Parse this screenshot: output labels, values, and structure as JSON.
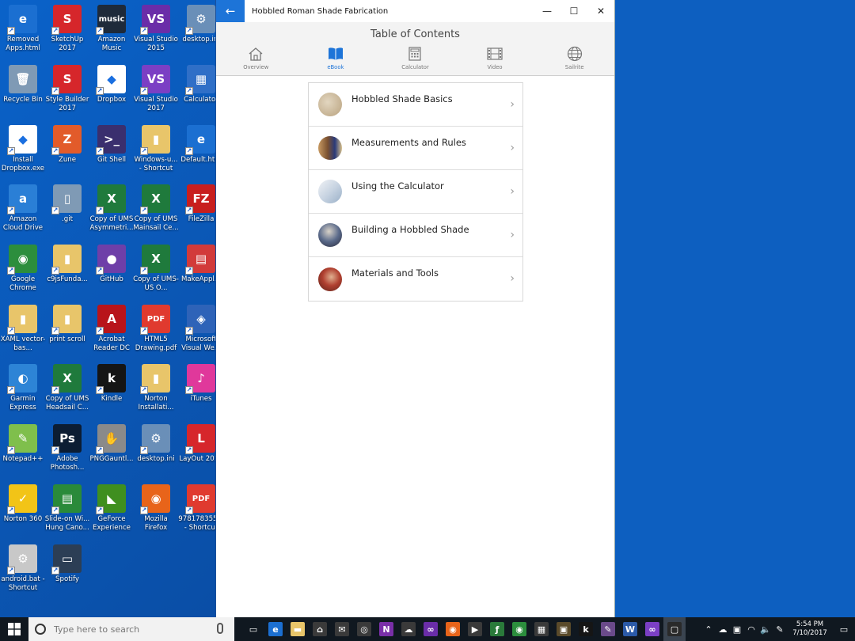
{
  "desktop": {
    "icons": [
      {
        "label": "Removed Apps.html",
        "color": "#1b6fd1",
        "glyph": "e"
      },
      {
        "label": "SketchUp 2017",
        "color": "#d6262b",
        "glyph": "S"
      },
      {
        "label": "Amazon Music",
        "color": "#1e2a3a",
        "glyph": "music"
      },
      {
        "label": "Visual Studio 2015",
        "color": "#6a2da8",
        "glyph": "VS"
      },
      {
        "label": "desktop.ini",
        "color": "#6a8fb8",
        "glyph": "⚙"
      },
      {
        "label": "Recycle Bin",
        "color": "#7f9ab5",
        "glyph": "🗑"
      },
      {
        "label": "Style Builder 2017",
        "color": "#d6262b",
        "glyph": "S"
      },
      {
        "label": "Dropbox",
        "color": "#ffffff",
        "glyph": "◆"
      },
      {
        "label": "Visual Studio 2017",
        "color": "#7b3fc4",
        "glyph": "VS"
      },
      {
        "label": "Calculator",
        "color": "#2f6fc7",
        "glyph": "▦"
      },
      {
        "label": "Install Dropbox.exe",
        "color": "#ffffff",
        "glyph": "◆"
      },
      {
        "label": "Zune",
        "color": "#e25b2a",
        "glyph": "Z"
      },
      {
        "label": "Git Shell",
        "color": "#3a2f6e",
        "glyph": ">_"
      },
      {
        "label": "Windows-u... - Shortcut",
        "color": "#e8c56a",
        "glyph": "▮"
      },
      {
        "label": "Default.htm",
        "color": "#1b6fd1",
        "glyph": "e"
      },
      {
        "label": "Amazon Cloud Drive",
        "color": "#2a7fd6",
        "glyph": "a"
      },
      {
        "label": ".git",
        "color": "#7f9ab5",
        "glyph": "▯"
      },
      {
        "label": "Copy of UMS Asymmetri...",
        "color": "#1f7a3c",
        "glyph": "X"
      },
      {
        "label": "Copy of UMS Mainsail Ce...",
        "color": "#1f7a3c",
        "glyph": "X"
      },
      {
        "label": "FileZilla",
        "color": "#c81e1e",
        "glyph": "FZ"
      },
      {
        "label": "Google Chrome",
        "color": "#2c8e3d",
        "glyph": "◉"
      },
      {
        "label": "c9jsFunda...",
        "color": "#e8c56a",
        "glyph": "▮"
      },
      {
        "label": "GitHub",
        "color": "#6e3fa8",
        "glyph": "●"
      },
      {
        "label": "Copy of UMS-US O...",
        "color": "#1f7a3c",
        "glyph": "X"
      },
      {
        "label": "MakeAppl...",
        "color": "#d23a3a",
        "glyph": "▤"
      },
      {
        "label": "XAML vector-bas...",
        "color": "#e8c56a",
        "glyph": "▮"
      },
      {
        "label": "print scroll",
        "color": "#e8c56a",
        "glyph": "▮"
      },
      {
        "label": "Acrobat Reader DC",
        "color": "#b8141a",
        "glyph": "A"
      },
      {
        "label": "HTML5 Drawing.pdf",
        "color": "#e03a2f",
        "glyph": "PDF"
      },
      {
        "label": "Microsoft Visual We...",
        "color": "#2e63b8",
        "glyph": "◈"
      },
      {
        "label": "Garmin Express",
        "color": "#2d84d6",
        "glyph": "◐"
      },
      {
        "label": "Copy of UMS Headsail C...",
        "color": "#1f7a3c",
        "glyph": "X"
      },
      {
        "label": "Kindle",
        "color": "#151515",
        "glyph": "k"
      },
      {
        "label": "Norton Installati...",
        "color": "#e8c56a",
        "glyph": "▮"
      },
      {
        "label": "iTunes",
        "color": "#e0389b",
        "glyph": "♪"
      },
      {
        "label": "Notepad++",
        "color": "#7fbf4c",
        "glyph": "✎"
      },
      {
        "label": "Adobe Photosh...",
        "color": "#0c1d33",
        "glyph": "Ps"
      },
      {
        "label": "PNGGauntl...",
        "color": "#8a8a8a",
        "glyph": "✋"
      },
      {
        "label": "desktop.ini",
        "color": "#6a8fb8",
        "glyph": "⚙"
      },
      {
        "label": "LayOut 2017",
        "color": "#d6262b",
        "glyph": "L"
      },
      {
        "label": "Norton 360",
        "color": "#f2c417",
        "glyph": "✓"
      },
      {
        "label": "Slide-on Wi... Hung Cano...",
        "color": "#2a8a3a",
        "glyph": "▤"
      },
      {
        "label": "GeForce Experience",
        "color": "#3f8f1f",
        "glyph": "◣"
      },
      {
        "label": "Mozilla Firefox",
        "color": "#e8641a",
        "glyph": "◉"
      },
      {
        "label": "978178355... - Shortcut",
        "color": "#e03a2f",
        "glyph": "PDF"
      },
      {
        "label": "android.bat - Shortcut",
        "color": "#c8c8c8",
        "glyph": "⚙"
      },
      {
        "label": "Spotify",
        "color": "#2c3e55",
        "glyph": "▭"
      }
    ]
  },
  "window": {
    "title": "Hobbled Roman Shade Fabrication",
    "back_icon": "←",
    "minimize": "—",
    "maximize": "☐",
    "close": "✕"
  },
  "toc": {
    "title": "Table of Contents",
    "tabs": [
      {
        "label": "Overview",
        "icon": "home-icon"
      },
      {
        "label": "eBook",
        "icon": "book-icon",
        "active": true
      },
      {
        "label": "Calculator",
        "icon": "calculator-icon"
      },
      {
        "label": "Video",
        "icon": "film-icon"
      },
      {
        "label": "Sailrite",
        "icon": "globe-icon"
      }
    ],
    "items": [
      {
        "label": "Hobbled Shade Basics",
        "thumb": "#c9b89a"
      },
      {
        "label": "Measurements and Rules",
        "thumb": "#8a6a4a"
      },
      {
        "label": "Using the Calculator",
        "thumb": "#b9c7d6"
      },
      {
        "label": "Building a Hobbled Shade",
        "thumb": "#4a5a7a"
      },
      {
        "label": "Materials and Tools",
        "thumb": "#9a3a2a"
      }
    ]
  },
  "taskbar": {
    "search_placeholder": "Type here to search",
    "apps": [
      {
        "name": "task-view",
        "color": "#101820",
        "glyph": "▭"
      },
      {
        "name": "edge",
        "color": "#1b6fd1",
        "glyph": "e"
      },
      {
        "name": "file-explorer",
        "color": "#e8c56a",
        "glyph": "▬"
      },
      {
        "name": "store",
        "color": "#3a3a3a",
        "glyph": "⌂"
      },
      {
        "name": "mail",
        "color": "#3a3a3a",
        "glyph": "✉"
      },
      {
        "name": "groove",
        "color": "#3a3a3a",
        "glyph": "◎"
      },
      {
        "name": "onenote",
        "color": "#7a2fa8",
        "glyph": "N"
      },
      {
        "name": "app",
        "color": "#3a3a3a",
        "glyph": "☁"
      },
      {
        "name": "visual-studio",
        "color": "#6a2da8",
        "glyph": "∞"
      },
      {
        "name": "firefox",
        "color": "#e8641a",
        "glyph": "◉"
      },
      {
        "name": "media",
        "color": "#3a3a3a",
        "glyph": "▶"
      },
      {
        "name": "formula",
        "color": "#2a7a3a",
        "glyph": "ƒ"
      },
      {
        "name": "chrome",
        "color": "#2c8e3d",
        "glyph": "◉"
      },
      {
        "name": "calculator",
        "color": "#3a3a3a",
        "glyph": "▦"
      },
      {
        "name": "photo",
        "color": "#5a4a2a",
        "glyph": "▣"
      },
      {
        "name": "kindle",
        "color": "#151515",
        "glyph": "k"
      },
      {
        "name": "app2",
        "color": "#6a4a8a",
        "glyph": "✎"
      },
      {
        "name": "word",
        "color": "#2b5aa8",
        "glyph": "W"
      },
      {
        "name": "visual-studio-2",
        "color": "#7b3fc4",
        "glyph": "∞"
      },
      {
        "name": "shade-app",
        "color": "#2a2a2a",
        "glyph": "▢"
      }
    ],
    "time": "5:54 PM",
    "date": "7/10/2017"
  }
}
